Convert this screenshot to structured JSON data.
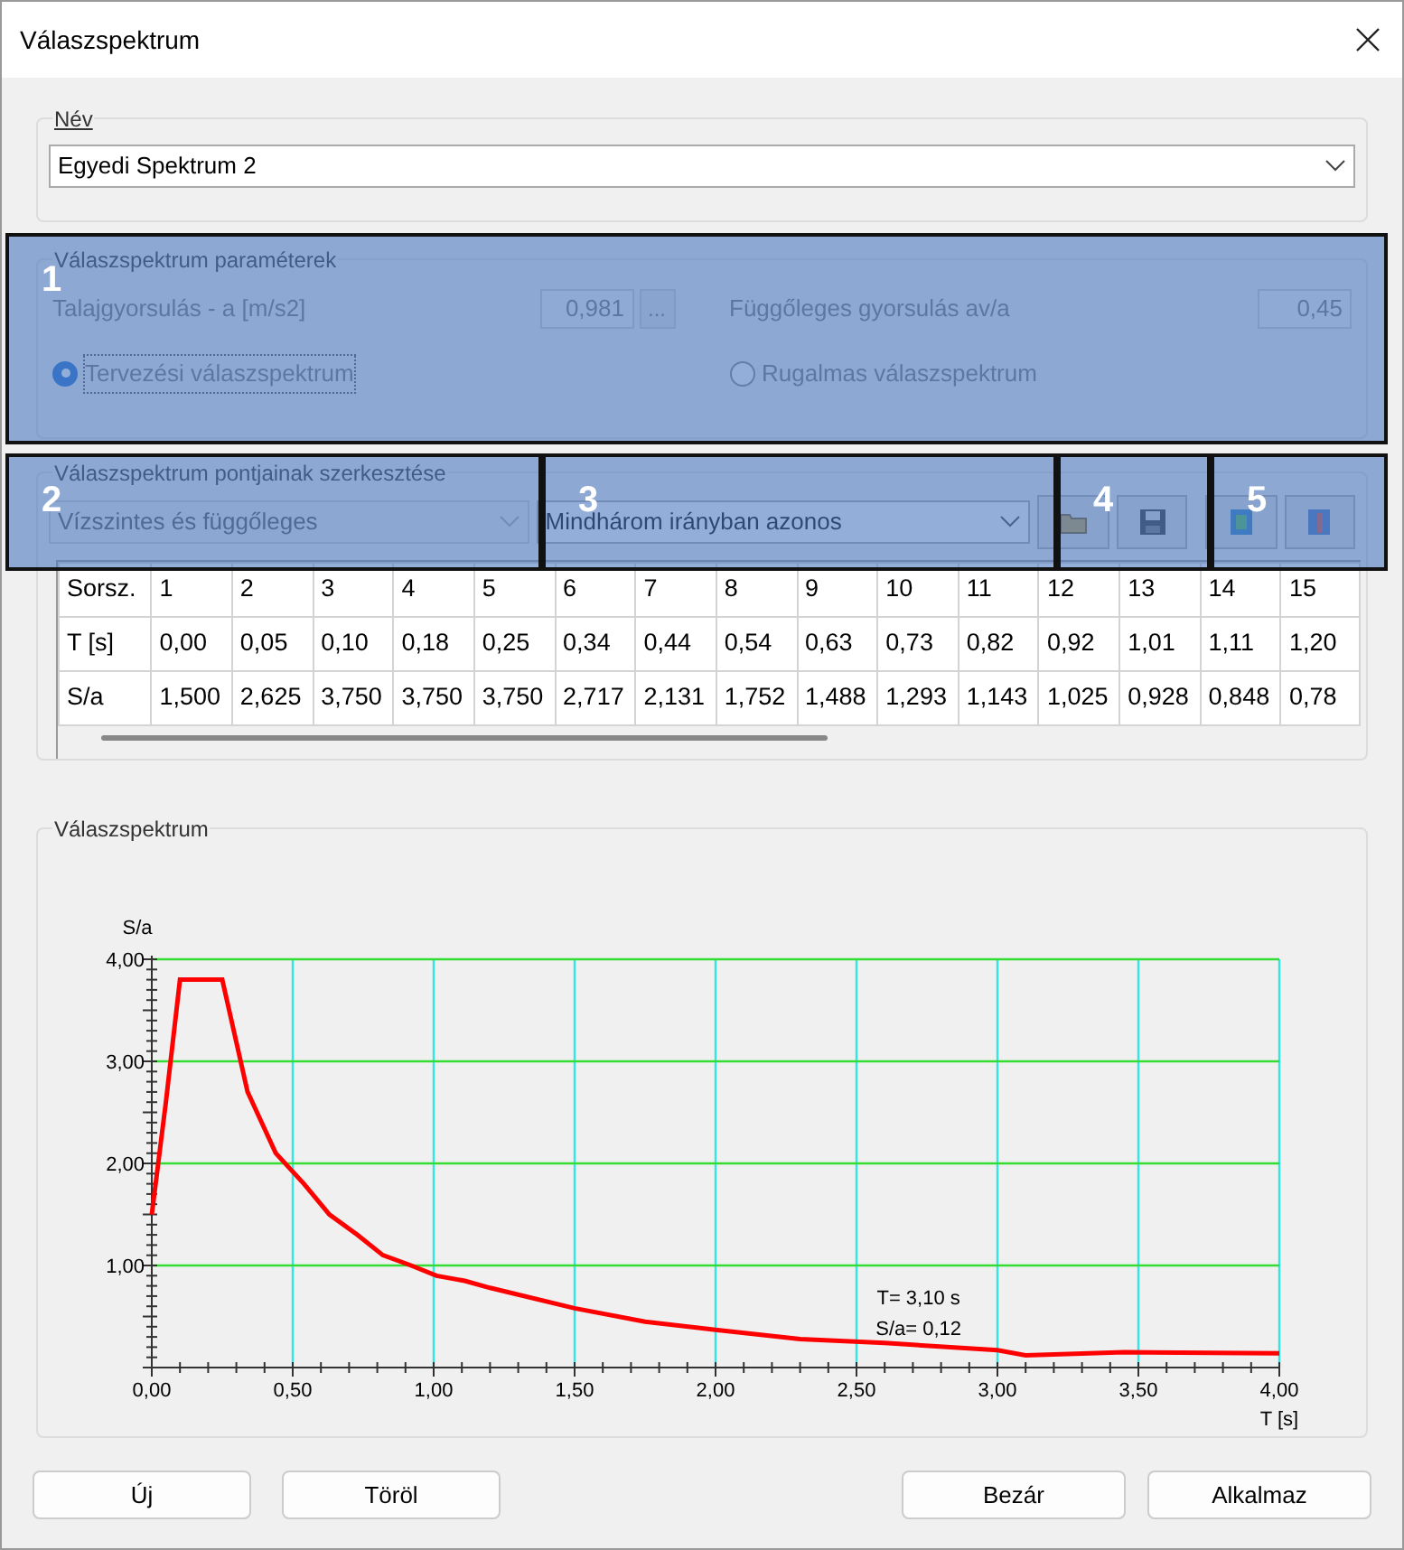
{
  "window": {
    "title": "Válaszspektrum"
  },
  "name_group": {
    "label": "Név",
    "value": "Egyedi Spektrum 2"
  },
  "parameters": {
    "title": "Válaszspektrum paraméterek",
    "ground_accel_label": "Talajgyorsulás - a [m/s2]",
    "ground_accel_value": "0,981",
    "ellipsis": "...",
    "vertical_label": "Függőleges gyorsulás av/a",
    "vertical_value": "0,45",
    "radios": [
      {
        "label": "Tervezési válaszspektrum",
        "selected": true
      },
      {
        "label": "Rugalmas válaszspektrum",
        "selected": false
      }
    ]
  },
  "editing": {
    "title": "Válaszspektrum pontjainak szerkesztése",
    "direction": "Vízszintes és függőleges",
    "mode": "Mindhárom irányban azonos",
    "rows": [
      [
        "Sorsz.",
        "1",
        "2",
        "3",
        "4",
        "5",
        "6",
        "7",
        "8",
        "9",
        "10",
        "11",
        "12",
        "13",
        "14",
        "15"
      ],
      [
        "T [s]",
        "0,00",
        "0,05",
        "0,10",
        "0,18",
        "0,25",
        "0,34",
        "0,44",
        "0,54",
        "0,63",
        "0,73",
        "0,82",
        "0,92",
        "1,01",
        "1,11",
        "1,20"
      ],
      [
        "S/a",
        "1,500",
        "2,625",
        "3,750",
        "3,750",
        "3,750",
        "2,717",
        "2,131",
        "1,752",
        "1,488",
        "1,293",
        "1,143",
        "1,025",
        "0,928",
        "0,848",
        "0,78"
      ]
    ]
  },
  "chart_group": {
    "title": "Válaszspektrum",
    "chart_data": {
      "type": "line",
      "xlabel": "T [s]",
      "ylabel": "S/a",
      "x": [
        0,
        0.05,
        0.1,
        0.18,
        0.25,
        0.34,
        0.44,
        0.54,
        0.63,
        0.73,
        0.82,
        0.92,
        1.01,
        1.11,
        1.2,
        1.5,
        1.75,
        2.0,
        2.3,
        2.6,
        3.0,
        3.1,
        3.45,
        4.0
      ],
      "series": [
        {
          "color": "#ff0000",
          "values": [
            1.5,
            2.6,
            3.8,
            3.8,
            3.8,
            2.7,
            2.1,
            1.8,
            1.5,
            1.3,
            1.1,
            1.0,
            0.9,
            0.85,
            0.78,
            0.58,
            0.45,
            0.37,
            0.28,
            0.24,
            0.17,
            0.12,
            0.15,
            0.14
          ]
        }
      ],
      "grid": true,
      "xlim": [
        0,
        4
      ],
      "ylim": [
        0,
        4
      ],
      "xticks": [
        {
          "value": 0,
          "label": "0,00"
        },
        {
          "value": 0.5,
          "label": "0,50"
        },
        {
          "value": 1,
          "label": "1,00"
        },
        {
          "value": 1.5,
          "label": "1,50"
        },
        {
          "value": 2,
          "label": "2,00"
        },
        {
          "value": 2.5,
          "label": "2,50"
        },
        {
          "value": 3,
          "label": "3,00"
        },
        {
          "value": 3.5,
          "label": "3,50"
        },
        {
          "value": 4,
          "label": "4,00"
        }
      ],
      "yticks": [
        {
          "value": 1,
          "label": "1,00"
        },
        {
          "value": 2,
          "label": "2,00"
        },
        {
          "value": 3,
          "label": "3,00"
        },
        {
          "value": 4,
          "label": "4,00"
        }
      ],
      "annotations": [
        "T= 3,10 s",
        "S/a= 0,12"
      ]
    }
  },
  "buttons_left": [
    "Új",
    "Töröl"
  ],
  "buttons_right": [
    "Bezár",
    "Alkalmaz"
  ],
  "callouts": [
    {
      "label": "1"
    },
    {
      "label": "2"
    },
    {
      "label": "3"
    },
    {
      "label": "4"
    },
    {
      "label": "5"
    }
  ]
}
